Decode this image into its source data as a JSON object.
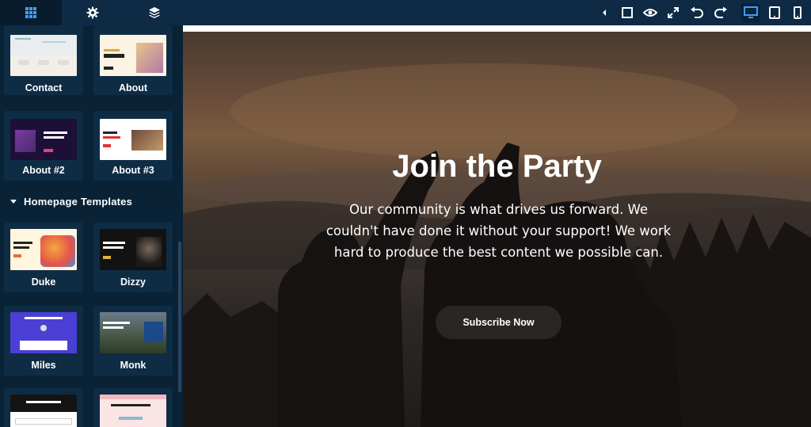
{
  "topbar": {
    "tabs": [
      {
        "icon": "grid-icon"
      },
      {
        "icon": "gear-icon"
      },
      {
        "icon": "layers-icon"
      }
    ],
    "tools": [
      {
        "icon": "caret-left-icon"
      },
      {
        "icon": "square-icon"
      },
      {
        "icon": "eye-icon"
      },
      {
        "icon": "fullscreen-icon"
      },
      {
        "icon": "undo-icon"
      },
      {
        "icon": "redo-icon"
      },
      {
        "icon": "desktop-icon"
      },
      {
        "icon": "tablet-icon"
      },
      {
        "icon": "mobile-icon"
      }
    ]
  },
  "sidebar": {
    "about_templates": [
      "Contact",
      "About",
      "About #2",
      "About #3"
    ],
    "section_title": "Homepage Templates",
    "homepage_templates": [
      "Duke",
      "Dizzy",
      "Miles",
      "Monk"
    ]
  },
  "canvas": {
    "title": "Join the Party",
    "text": "Our community is what drives us forward. We couldn't have done it without your support! We work hard to produce the best content we possible can.",
    "button": "Subscribe Now"
  },
  "colors": {
    "topbar": "#0e2a44",
    "sidebar": "#0a2235",
    "card": "#0f2c45",
    "accent": "#1b8be0"
  }
}
